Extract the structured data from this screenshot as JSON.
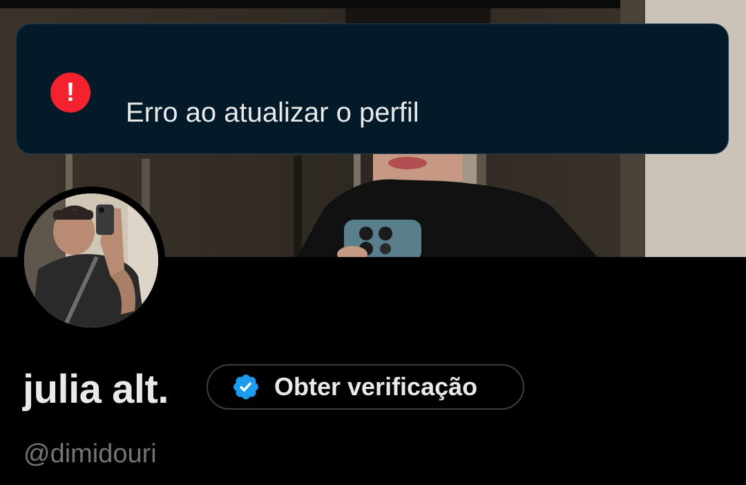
{
  "toast": {
    "icon": "error-exclamation-icon",
    "icon_glyph": "!",
    "message": "Erro ao atualizar o perfil",
    "background_color": "#041a29",
    "icon_color": "#f4212e"
  },
  "profile": {
    "display_name": "julia alt.",
    "handle": "@dimidouri",
    "banner_image": "header-photo",
    "avatar_image": "profile-photo"
  },
  "verification": {
    "button_label": "Obter verificação",
    "badge_icon": "verified-badge-icon",
    "badge_color": "#1d9bf0"
  }
}
